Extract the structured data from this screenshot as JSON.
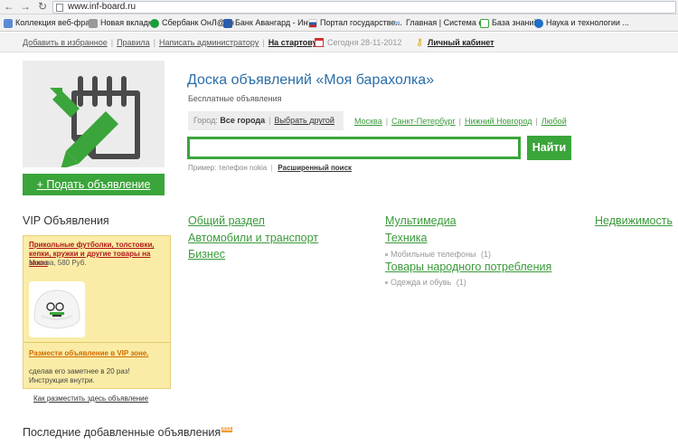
{
  "browser": {
    "url": "www.inf-board.ru",
    "bookmarks": [
      {
        "label": "Коллекция веб-фраг...",
        "icon": "page-icon",
        "color": "#5b8bd4"
      },
      {
        "label": "Новая вкладка",
        "icon": "page-icon",
        "color": "#888888"
      },
      {
        "label": "Сбербанк ОнЛ@йн",
        "icon": "sberbank-icon",
        "color": "#1a9e3a"
      },
      {
        "label": "Банк Авангард - Инт...",
        "icon": "bank-icon",
        "color": "#2a5caa"
      },
      {
        "label": "Портал государстве...",
        "icon": "flag-icon",
        "color": "#c22"
      },
      {
        "label": "Главная | Система о...",
        "icon": "infinity-icon",
        "color": "#3a7ad4"
      },
      {
        "label": "База знаний",
        "icon": "kb-icon",
        "color": "#3aa53a"
      },
      {
        "label": "Наука и технологии ...",
        "icon": "info-icon",
        "color": "#1e6fc8"
      }
    ]
  },
  "topbar": {
    "links": [
      "Добавить в избранное",
      "Правила",
      "Написать администратору"
    ],
    "home_link": "На стартовую",
    "today": "Сегодня 28-11-2012",
    "cabinet": "Личный кабинет"
  },
  "header": {
    "title": "Доска объявлений «Моя барахолка»",
    "subtitle": "Бесплатные объявления",
    "post_button": "+ Подать объявление",
    "city_label": "Город:",
    "city_value": "Все города",
    "choose_other": "Выбрать другой",
    "cities": [
      "Москва",
      "Санкт-Петербург",
      "Нижний Новгород",
      "Любой"
    ],
    "search_placeholder": "",
    "search_button": "Найти",
    "example_text": "Пример: телефон nokia",
    "advanced_search": "Расширенный поиск"
  },
  "vip": {
    "title": "VIP Объявления",
    "ad_title": "Прикольные футболки, толстовки, кепки, кружки и другие товары на заказ",
    "ad_meta": "Москва, 580 Руб.",
    "place_link": "Размести объявление в VIP зоне.",
    "place_note": "сделав его заметнее в 20 раз! Инструкция внутри.",
    "how_link": "Как разместить здесь объявление"
  },
  "categories": {
    "col1": [
      "Общий раздел",
      "Автомобили и транспорт",
      "Бизнес"
    ],
    "col2": {
      "multimedia": "Мультимедиа",
      "tech": "Техника",
      "tech_sub": {
        "label": "Мобильные телефоны",
        "count": "(1)"
      },
      "goods": "Товары народного потребления",
      "goods_sub": {
        "label": "Одежда и обувь",
        "count": "(1)"
      }
    },
    "col3": [
      "Недвижимость"
    ]
  },
  "latest": {
    "title": "Последние добавленные объявления",
    "rss": "RSS"
  },
  "colors": {
    "accent": "#3aa53a",
    "title": "#2a6ea8",
    "vip_bg": "#faeca6"
  }
}
